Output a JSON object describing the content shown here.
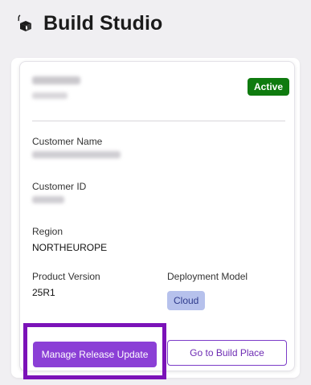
{
  "app": {
    "title": "Build Studio",
    "logo_icon": "box-icon"
  },
  "card": {
    "status_badge": "Active",
    "status_color": "#0f7b0f",
    "fields": {
      "customer_name_label": "Customer Name",
      "customer_id_label": "Customer ID",
      "region_label": "Region",
      "region_value": "NORTHEUROPE",
      "product_version_label": "Product Version",
      "product_version_value": "25R1",
      "deployment_model_label": "Deployment Model",
      "deployment_model_value": "Cloud"
    },
    "actions": {
      "manage_release_update": "Manage Release Update",
      "go_to_build_place": "Go to Build Place"
    }
  },
  "colors": {
    "accent": "#8b3fd6",
    "highlight_border": "#7b12b8",
    "cloud_chip_bg": "#b6c1ec"
  }
}
